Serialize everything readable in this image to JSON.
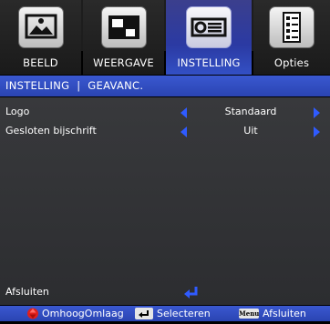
{
  "tabs": [
    {
      "label": "BEELD",
      "icon": "picture-icon",
      "active": false
    },
    {
      "label": "WEERGAVE",
      "icon": "display-icon",
      "active": false
    },
    {
      "label": "INSTELLING",
      "icon": "projector-icon",
      "active": true
    },
    {
      "label": "Opties",
      "icon": "options-icon",
      "active": false
    }
  ],
  "header": {
    "breadcrumb": "INSTELLING  |  GEAVANC."
  },
  "menu": {
    "items": [
      {
        "label": "Logo",
        "value": "Standaard"
      },
      {
        "label": "Gesloten bijschrift",
        "value": "Uit"
      }
    ],
    "exit_label": "Afsluiten"
  },
  "footer": {
    "updown_label": "OmhoogOmlaag",
    "select_label": "Selecteren",
    "menu_key_label": "Menu",
    "exit_label": "Afsluiten"
  },
  "colors": {
    "accent": "#2f5bff",
    "header": "#3350c4",
    "active_tab": "#2b3aa3",
    "updown_icon": "#e0201c"
  }
}
